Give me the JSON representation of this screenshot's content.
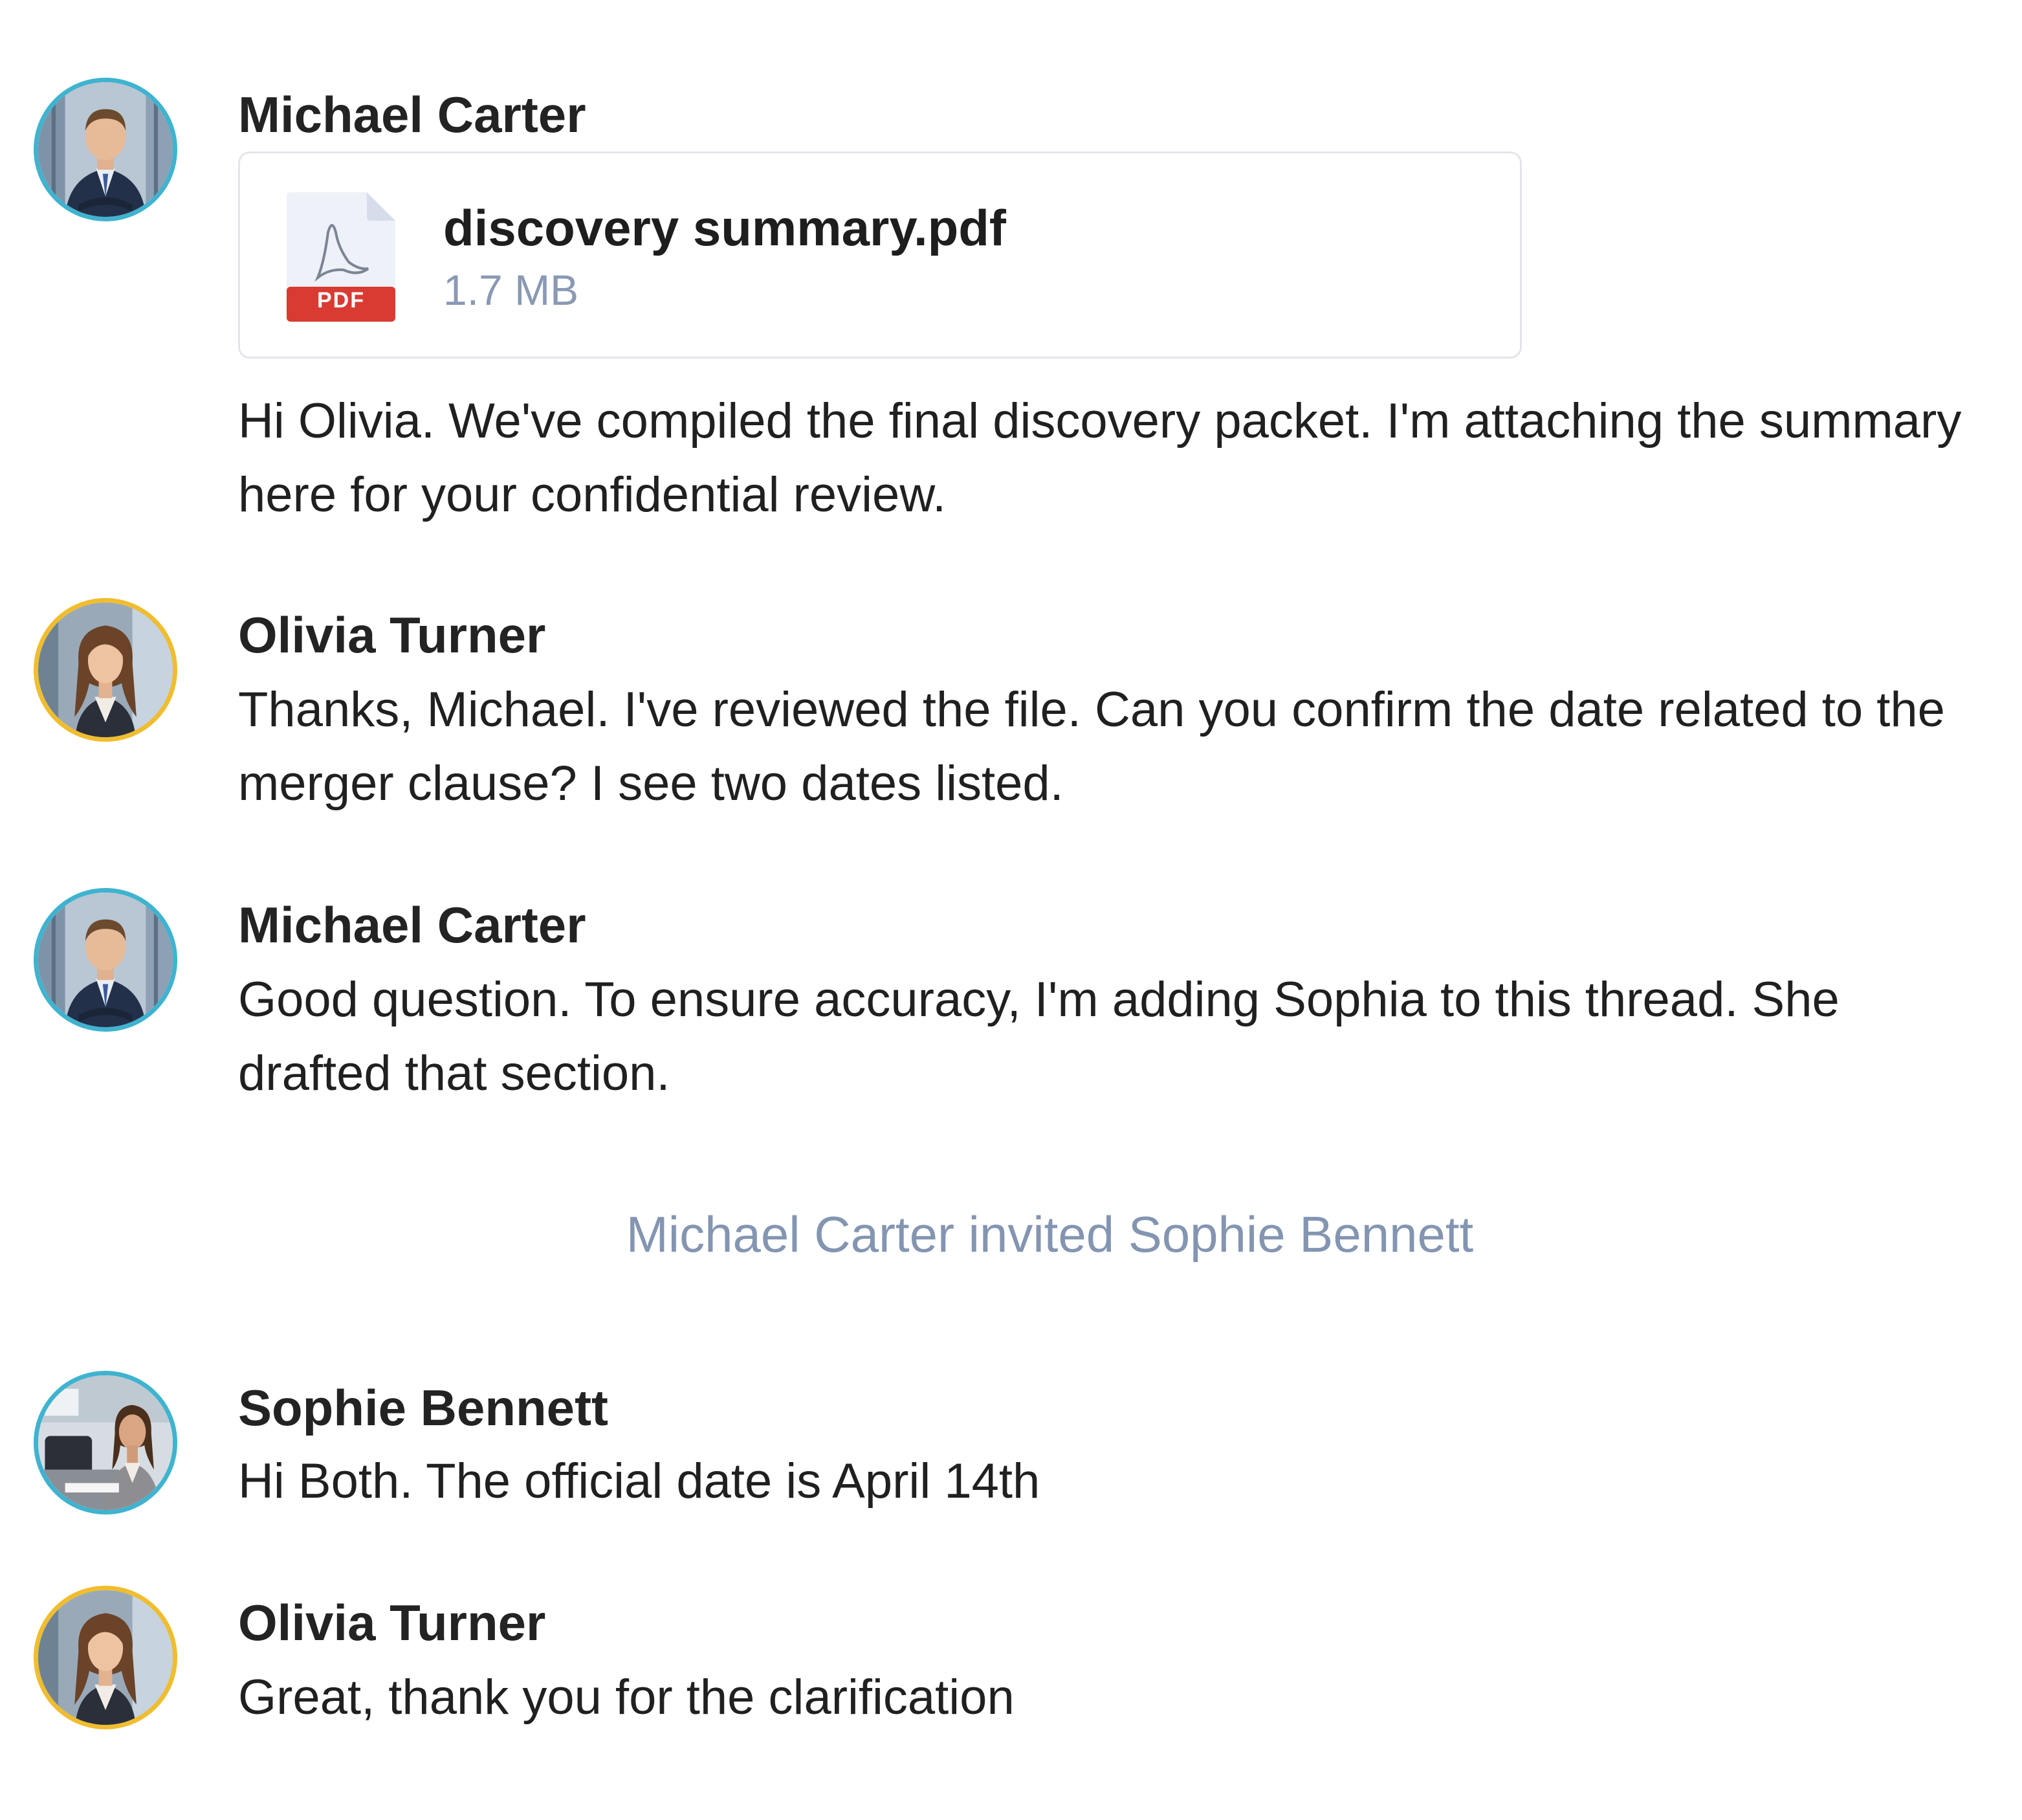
{
  "messages": [
    {
      "sender": "Michael Carter",
      "avatar_icon": "man-portrait-avatar",
      "avatar_ring_color": "#3fb3cf",
      "attachment": {
        "file_name": "discovery summary.pdf",
        "file_size": "1.7 MB",
        "file_type_label": "PDF",
        "icon": "pdf-file-icon"
      },
      "text": "Hi Olivia. We've compiled the final discovery packet. I'm attaching the summary here for your confidential review."
    },
    {
      "sender": "Olivia Turner",
      "avatar_icon": "woman-portrait-avatar",
      "avatar_ring_color": "#f0bd2e",
      "text": "Thanks, Michael. I've reviewed the file. Can you confirm the date related to the merger clause? I see two dates listed."
    },
    {
      "sender": "Michael Carter",
      "avatar_icon": "man-portrait-avatar",
      "avatar_ring_color": "#3fb3cf",
      "text": "Good question. To ensure accuracy, I'm adding Sophia to this thread. She drafted that section."
    },
    {
      "sender": "Sophie Bennett",
      "avatar_icon": "woman-at-desk-avatar",
      "avatar_ring_color": "#3fb3cf",
      "text": "Hi Both. The official date is April 14th"
    },
    {
      "sender": "Olivia Turner",
      "avatar_icon": "woman-portrait-avatar",
      "avatar_ring_color": "#f0bd2e",
      "text": "Great, thank you for the clarification"
    }
  ],
  "system_note": "Michael Carter invited Sophie Bennett"
}
